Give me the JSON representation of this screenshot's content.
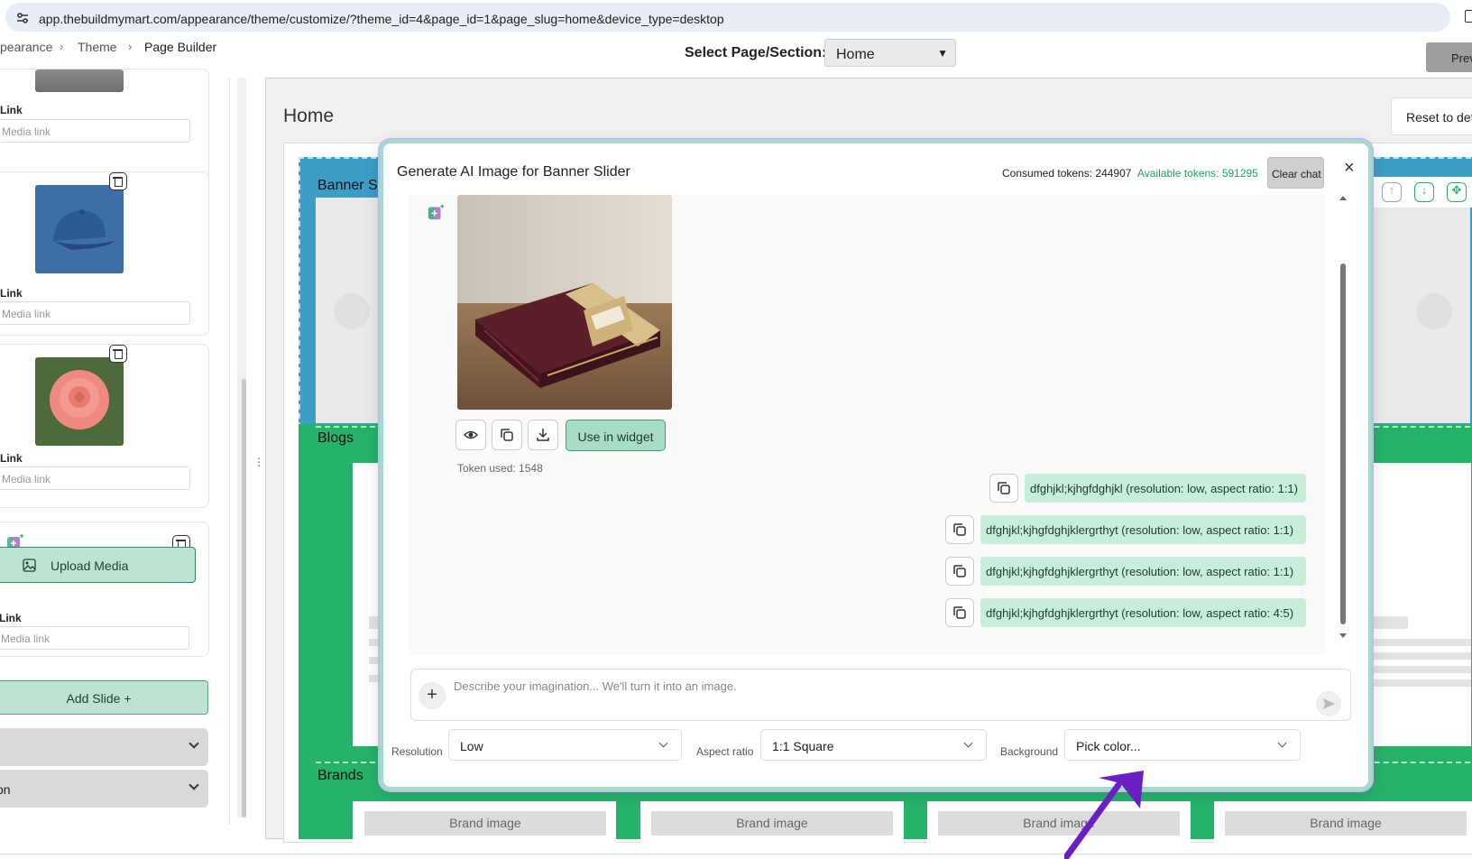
{
  "browser": {
    "url": "app.thebuildmymart.com/appearance/theme/customize/?theme_id=4&page_id=1&page_slug=home&device_type=desktop"
  },
  "breadcrumb": {
    "items": [
      "pearance",
      "Theme",
      "Page Builder"
    ]
  },
  "header": {
    "select_label": "Select Page/Section:",
    "select_value": "Home",
    "preview_label": "Previe"
  },
  "left_panel": {
    "link_label": "Link",
    "media_placeholder": "Media link",
    "upload_label": "Upload Media",
    "add_slide_label": "Add Slide +",
    "accordion_2_label": "on"
  },
  "canvas": {
    "page_title": "Home",
    "reset_label": "Reset to def",
    "banner_label": "Banner S",
    "blogs_label": "Blogs",
    "brands_label": "Brands",
    "brand_image_label": "Brand image"
  },
  "modal": {
    "title": "Generate AI Image for Banner Slider",
    "consumed_tokens": "Consumed tokens: 244907",
    "available_tokens": "Available tokens: 591295",
    "clear_chat_label": "Clear chat",
    "close_label": "×",
    "use_in_widget_label": "Use in widget",
    "token_used": "Token used: 1548",
    "messages": [
      "dfghjkl;kjhgfdghjkl (resolution: low, aspect ratio: 1:1)",
      "dfghjkl;kjhgfdghjklergrthyt (resolution: low, aspect ratio: 1:1)",
      "dfghjkl;kjhgfdghjklergrthyt (resolution: low, aspect ratio: 1:1)",
      "dfghjkl;kjhgfdghjklergrthyt (resolution: low, aspect ratio: 4:5)"
    ],
    "prompt_placeholder": "Describe your imagination... We'll turn it into an image.",
    "resolution_label": "Resolution",
    "resolution_value": "Low",
    "aspect_label": "Aspect ratio",
    "aspect_value": "1:1 Square",
    "background_label": "Background",
    "background_value": "Pick color..."
  },
  "colors": {
    "accent_green": "#27b26a",
    "mint": "#c7eddb",
    "banner_blue": "#3c9ec5",
    "annotation_arrow": "#6a1fc2"
  }
}
